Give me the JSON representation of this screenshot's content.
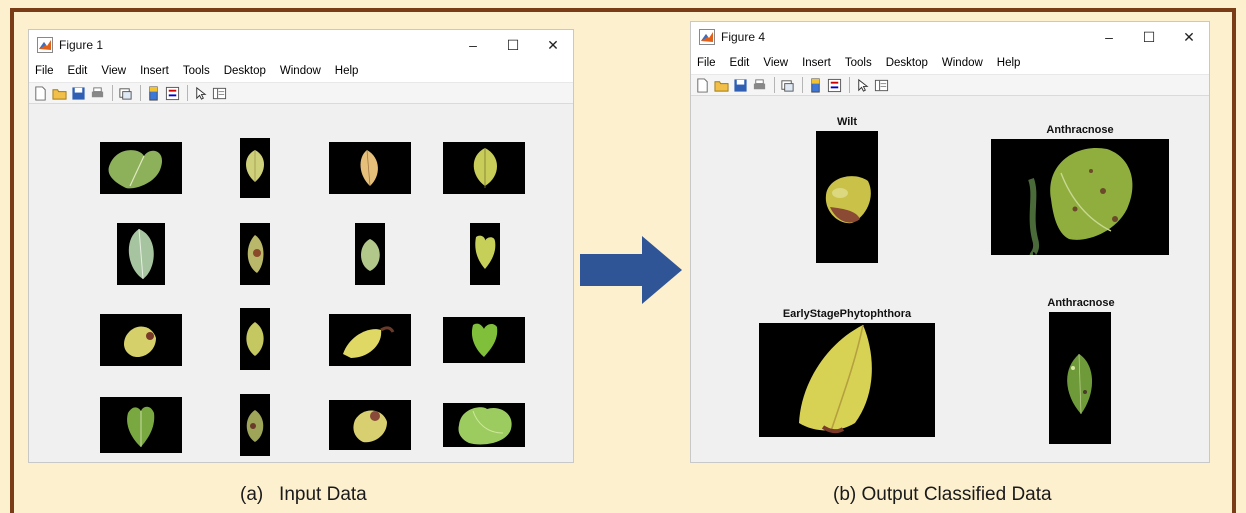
{
  "input_window": {
    "title": "Figure 1",
    "menu": [
      "File",
      "Edit",
      "View",
      "Insert",
      "Tools",
      "Desktop",
      "Window",
      "Help"
    ],
    "controls": [
      "–",
      "☐",
      "✕"
    ]
  },
  "output_window": {
    "title": "Figure 4",
    "menu": [
      "File",
      "Edit",
      "View",
      "Insert",
      "Tools",
      "Desktop",
      "Window",
      "Help"
    ],
    "controls": [
      "–",
      "☐",
      "✕"
    ],
    "panels": [
      {
        "title": "Wilt"
      },
      {
        "title": "Anthracnose"
      },
      {
        "title": "EarlyStagePhytophthora"
      },
      {
        "title": "Anthracnose"
      }
    ]
  },
  "captions": {
    "left": "(a)   Input Data",
    "right": "(b) Output Classified Data"
  },
  "colors": {
    "border": "#7a3b17",
    "background": "#fdf0cf",
    "arrow": "#2f5597"
  }
}
